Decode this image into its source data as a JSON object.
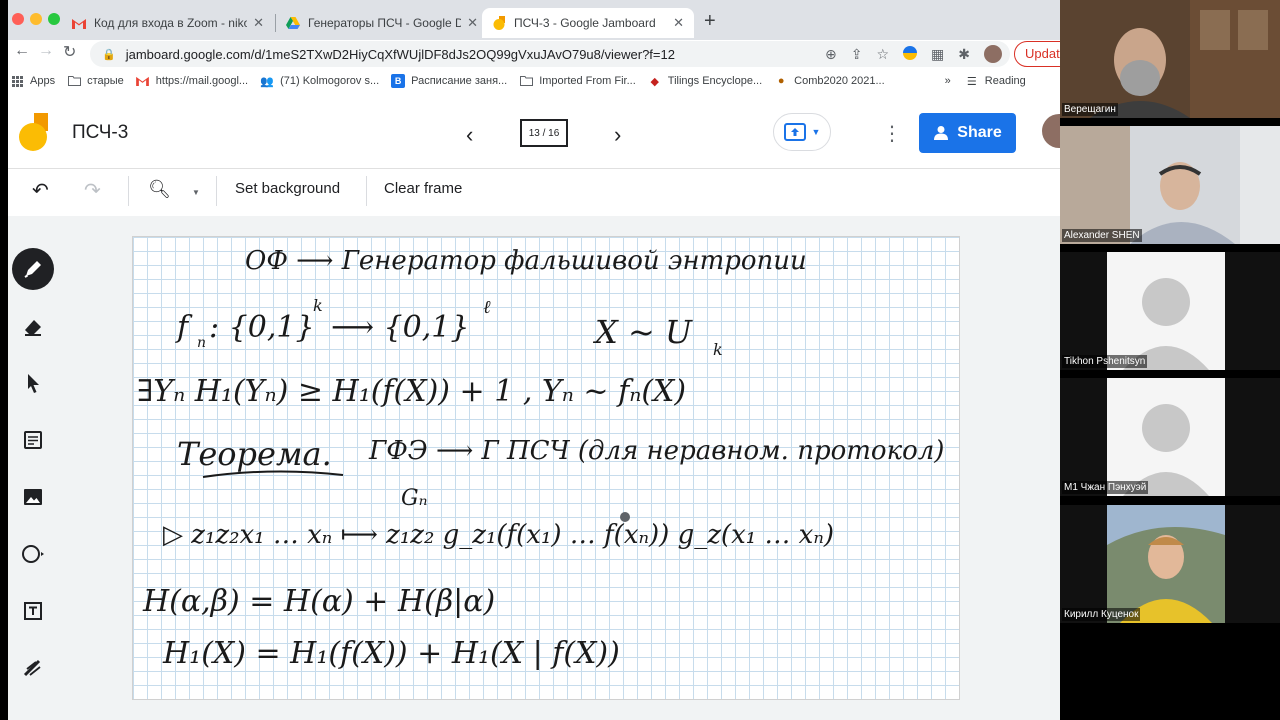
{
  "browser": {
    "tabs": [
      {
        "title": "Код для входа в Zoom - nikola",
        "icon": "gmail-icon",
        "active": false
      },
      {
        "title": "Генераторы ПСЧ - Google Dri",
        "icon": "drive-icon",
        "active": false
      },
      {
        "title": "ПСЧ-3 - Google Jamboard",
        "icon": "jamboard-icon",
        "active": true
      }
    ],
    "url": "jamboard.google.com/d/1meS2TXwD2HiyCqXfWUjlDF8dJs2OQ99gVxuJAvO79u8/viewer?f=12",
    "update_label": "Update",
    "bookmarks": [
      {
        "label": "Apps",
        "icon": "apps-grid-icon"
      },
      {
        "label": "старые",
        "icon": "folder-icon"
      },
      {
        "label": "https://mail.googl...",
        "icon": "gmail-icon"
      },
      {
        "label": "(71) Kolmogorov s...",
        "icon": "people-icon"
      },
      {
        "label": "Расписание заня...",
        "icon": "schedule-icon"
      },
      {
        "label": "Imported From Fir...",
        "icon": "folder-icon"
      },
      {
        "label": "Tilings Encyclope...",
        "icon": "diamond-icon"
      },
      {
        "label": "Comb2020 2021...",
        "icon": "mushroom-icon"
      }
    ],
    "bookmarks_overflow": "»",
    "reading_list": "Reading"
  },
  "app": {
    "title": "ПСЧ-3",
    "frame_counter": "13 / 16",
    "share_label": "Share"
  },
  "edit_tools": {
    "set_background": "Set background",
    "clear_frame": "Clear frame"
  },
  "side_tools": [
    "pen-icon",
    "eraser-icon",
    "select-arrow-icon",
    "sticky-note-icon",
    "image-icon",
    "circle-shape-icon",
    "text-box-icon",
    "laser-icon"
  ],
  "whiteboard": {
    "line1": "ОФ ⟶ Генератор фальшивой энтропии",
    "line2a": "f",
    "line2b": "n",
    "line2c": ": {0,1}",
    "line2d": "k",
    "line2e": " ⟶ {0,1}",
    "line2f": "ℓ",
    "line2g": "X ~ U",
    "line2h": "k",
    "line3": "∃Yₙ H₁(Yₙ) ≥ H₁(f(X)) + 1   , Yₙ ~ fₙ(X)",
    "line4a": "Теорема.",
    "line4b": "ГФЭ ⟶ Г ПСЧ  (для неравном. протокол)",
    "line5a": "Gₙ",
    "line5b": "▷   z₁z₂x₁ … xₙ ⟼ z₁z₂ g_z₁(f(x₁) … f(xₙ)) g_z(x₁ … xₙ)",
    "line6": "H(α,β) = H(α) + H(β|α)",
    "line7": "H₁(X) = H₁(f(X)) + H₁(X | f(X))"
  },
  "participants": [
    {
      "name": "Верещагин",
      "type": "video"
    },
    {
      "name": "Alexander SHEN",
      "type": "video"
    },
    {
      "name": "Tikhon Pshenitsyn",
      "type": "avatar"
    },
    {
      "name": "М1 Чжан Пэнхуэй",
      "type": "avatar"
    },
    {
      "name": "Кирилл Куценок",
      "type": "video"
    }
  ],
  "colors": {
    "accent": "#1a73e8",
    "grid": "#c7dcec",
    "tab_bar": "#dee1e6"
  }
}
